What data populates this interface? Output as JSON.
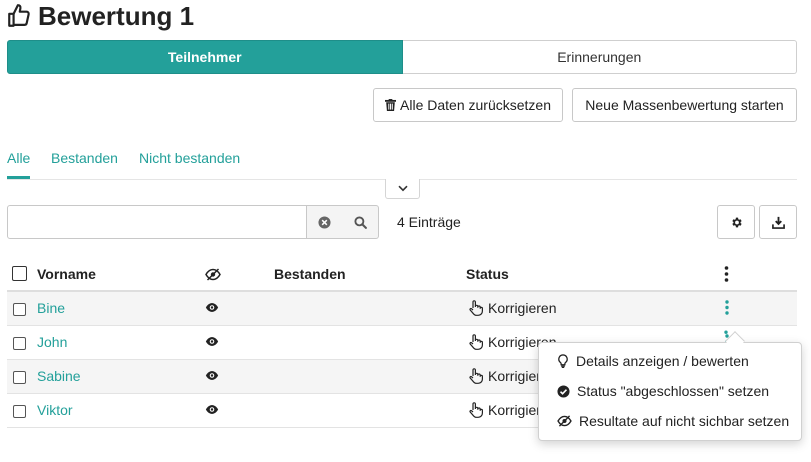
{
  "page": {
    "title": "Bewertung 1",
    "title_icon": "thumbs-up-icon"
  },
  "segments": [
    {
      "label": "Teilnehmer",
      "active": true
    },
    {
      "label": "Erinnerungen",
      "active": false
    }
  ],
  "actions": {
    "reset_label": "Alle Daten zurücksetzen",
    "reset_icon": "trash-icon",
    "bulk_label": "Neue Massenbewertung starten"
  },
  "filter_tabs": [
    {
      "label": "Alle",
      "active": true
    },
    {
      "label": "Bestanden",
      "active": false
    },
    {
      "label": "Nicht bestanden",
      "active": false
    }
  ],
  "search": {
    "value": "",
    "count_label": "4 Einträge"
  },
  "table": {
    "headers": {
      "firstname": "Vorname",
      "passed": "Bestanden",
      "status": "Status"
    },
    "rows": [
      {
        "firstname": "Bine",
        "passed": "",
        "status": "Korrigieren"
      },
      {
        "firstname": "John",
        "passed": "",
        "status": "Korrigieren"
      },
      {
        "firstname": "Sabine",
        "passed": "",
        "status": "Korrigieren"
      },
      {
        "firstname": "Viktor",
        "passed": "",
        "status": "Korrigieren"
      }
    ]
  },
  "popover": {
    "items": [
      {
        "label": "Details anzeigen / bewerten",
        "icon": "lightbulb-icon"
      },
      {
        "label": "Status \"abgeschlossen\" setzen",
        "icon": "check-circle-icon"
      },
      {
        "label": "Resultate auf nicht sichbar setzen",
        "icon": "eye-slash-icon"
      }
    ]
  },
  "colors": {
    "accent": "#23a09a",
    "row_stripe": "#f5f5f5"
  }
}
